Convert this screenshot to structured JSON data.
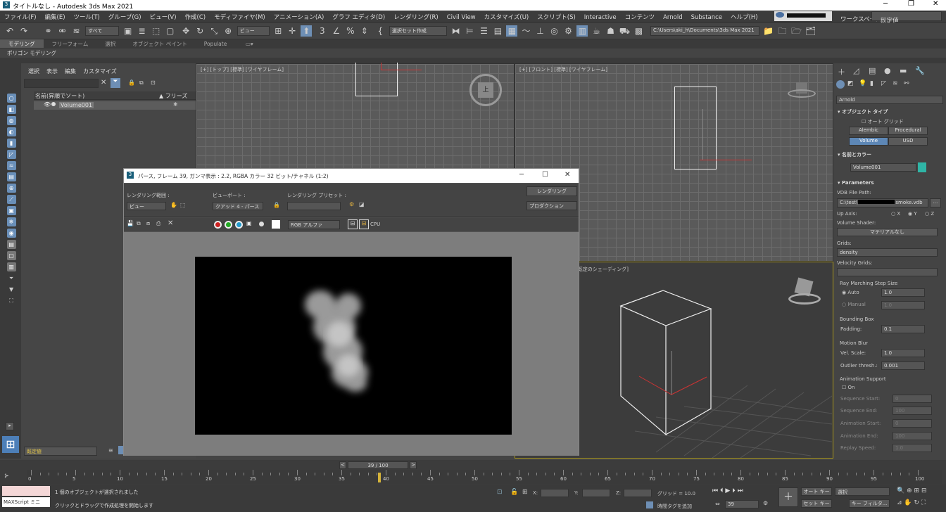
{
  "window": {
    "title": "タイトルなし - Autodesk 3ds Max 2021"
  },
  "menu": [
    "ファイル(F)",
    "編集(E)",
    "ツール(T)",
    "グループ(G)",
    "ビュー(V)",
    "作成(C)",
    "モディファイヤ(M)",
    "アニメーション(A)",
    "グラフ エディタ(D)",
    "レンダリング(R)",
    "Civil View",
    "カスタマイズ(U)",
    "スクリプト(S)",
    "Interactive",
    "コンテンツ",
    "Arnold",
    "Substance",
    "ヘルプ(H)"
  ],
  "workspace": {
    "label": "ワークスペース:",
    "value": "既定値"
  },
  "toolbar": {
    "filter": "すべて",
    "refcoord": "ビュー",
    "selset": "選択セット作成",
    "path": "C:\\Users\\aki_h\\Documents\\3ds Max 2021"
  },
  "ribbon": {
    "tabs": [
      "モデリング",
      "フリーフォーム",
      "選択",
      "オブジェクト ペイント",
      "Populate"
    ],
    "sub": "ポリゴン モデリング"
  },
  "scene": {
    "menus": [
      "選択",
      "表示",
      "編集",
      "カスタマイズ"
    ],
    "col_name": "名前(昇順でソート)",
    "col_freeze": "▲ フリーズ",
    "item": "Volume001"
  },
  "viewports": {
    "top": "[+] [トップ] [標準] [ワイヤフレーム]",
    "front": "[+] [フロント] [標準] [ワイヤフレーム]",
    "persp": "[既定のシェーディング]",
    "cube_top": "上"
  },
  "render": {
    "title": "パース, フレーム 39, ガンマ表示 : 2.2, RGBA カラー 32 ビット/チャネル (1:2)",
    "area_label": "レンダリング範囲 :",
    "area_value": "ビュー",
    "viewport_label": "ビューポート :",
    "viewport_value": "クアッド 4 - パース",
    "preset_label": "レンダリング プリセット :",
    "preset_value": "",
    "render_btn": "レンダリング",
    "mode": "プロダクション",
    "channel": "RGB アルファ",
    "cpu": "CPU"
  },
  "panel": {
    "renderer": "Arnold",
    "objtype": "オブジェクト タイプ",
    "autogrid": "オート グリッド",
    "types": [
      "Alembic",
      "Procedural",
      "Volume",
      "USD"
    ],
    "namecolor": "名前とカラー",
    "name": "Volume001",
    "color": "#2fb5a6",
    "params": "Parameters",
    "vdb_label": "VDB File Path:",
    "vdb_value": "C:\\test\\",
    "vdb_suffix": "smoke.vdb",
    "axis_label": "Up Axis:",
    "axes": [
      "X",
      "Y",
      "Z"
    ],
    "shader_label": "Volume Shader:",
    "shader": "マテリアルなし",
    "grids_label": "Grids:",
    "grids": "density",
    "vgrids_label": "Velocity Grids:",
    "ray": "Ray Marching Step Size",
    "auto": "Auto",
    "auto_val": "1.0",
    "manual": "Manual",
    "manual_val": "1.0",
    "bbox": "Bounding Box",
    "padding": "Padding:",
    "padding_val": "0.1",
    "blur": "Motion Blur",
    "vel": "Vel. Scale:",
    "vel_val": "1.0",
    "outlier": "Outlier thresh.:",
    "outlier_val": "0.001",
    "anim": "Animation Support",
    "on": "On",
    "seqstart": "Sequence Start:",
    "seqstart_val": "0",
    "seqend": "Sequence End:",
    "seqend_val": "100",
    "animstart": "Animation Start:",
    "animstart_val": "0",
    "animend": "Animation End:",
    "animend_val": "100",
    "replay": "Replay Speed:",
    "replay_val": "1.0"
  },
  "timeline": {
    "frame": "39 / 100",
    "ticks": [
      "0",
      "5",
      "10",
      "15",
      "20",
      "25",
      "30",
      "35",
      "40",
      "45",
      "50",
      "55",
      "60",
      "65",
      "70",
      "75",
      "80",
      "85",
      "90",
      "95",
      "100"
    ]
  },
  "status": {
    "layer": "既定値",
    "maxscript": "MAXScript ミニ",
    "msg1": "1 個のオブジェクトが選択されました",
    "msg2": "クリックとドラッグで作成処理を開始します",
    "x": "X:",
    "y": "Y:",
    "z": "Z:",
    "grid": "グリッド = 10.0",
    "timetag": "時間タグを追加",
    "autokey": "オート キー",
    "setkey": "セット キー",
    "sel": "選択",
    "keyfilter": "キー フィルタ...",
    "frame": "39"
  }
}
